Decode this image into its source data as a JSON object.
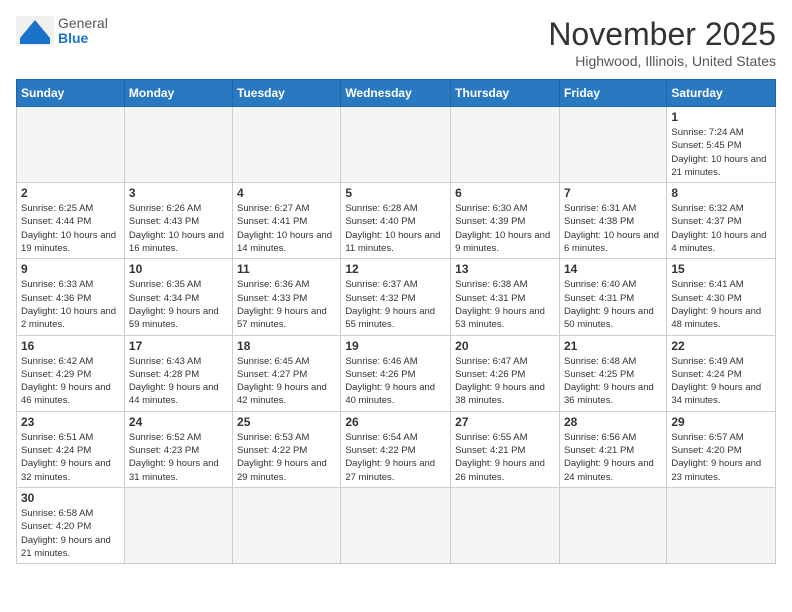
{
  "logo": {
    "general": "General",
    "blue": "Blue"
  },
  "title": "November 2025",
  "location": "Highwood, Illinois, United States",
  "weekdays": [
    "Sunday",
    "Monday",
    "Tuesday",
    "Wednesday",
    "Thursday",
    "Friday",
    "Saturday"
  ],
  "weeks": [
    [
      {
        "day": null,
        "info": null
      },
      {
        "day": null,
        "info": null
      },
      {
        "day": null,
        "info": null
      },
      {
        "day": null,
        "info": null
      },
      {
        "day": null,
        "info": null
      },
      {
        "day": null,
        "info": null
      },
      {
        "day": "1",
        "info": "Sunrise: 7:24 AM\nSunset: 5:45 PM\nDaylight: 10 hours and 21 minutes."
      }
    ],
    [
      {
        "day": "2",
        "info": "Sunrise: 6:25 AM\nSunset: 4:44 PM\nDaylight: 10 hours and 19 minutes."
      },
      {
        "day": "3",
        "info": "Sunrise: 6:26 AM\nSunset: 4:43 PM\nDaylight: 10 hours and 16 minutes."
      },
      {
        "day": "4",
        "info": "Sunrise: 6:27 AM\nSunset: 4:41 PM\nDaylight: 10 hours and 14 minutes."
      },
      {
        "day": "5",
        "info": "Sunrise: 6:28 AM\nSunset: 4:40 PM\nDaylight: 10 hours and 11 minutes."
      },
      {
        "day": "6",
        "info": "Sunrise: 6:30 AM\nSunset: 4:39 PM\nDaylight: 10 hours and 9 minutes."
      },
      {
        "day": "7",
        "info": "Sunrise: 6:31 AM\nSunset: 4:38 PM\nDaylight: 10 hours and 6 minutes."
      },
      {
        "day": "8",
        "info": "Sunrise: 6:32 AM\nSunset: 4:37 PM\nDaylight: 10 hours and 4 minutes."
      }
    ],
    [
      {
        "day": "9",
        "info": "Sunrise: 6:33 AM\nSunset: 4:36 PM\nDaylight: 10 hours and 2 minutes."
      },
      {
        "day": "10",
        "info": "Sunrise: 6:35 AM\nSunset: 4:34 PM\nDaylight: 9 hours and 59 minutes."
      },
      {
        "day": "11",
        "info": "Sunrise: 6:36 AM\nSunset: 4:33 PM\nDaylight: 9 hours and 57 minutes."
      },
      {
        "day": "12",
        "info": "Sunrise: 6:37 AM\nSunset: 4:32 PM\nDaylight: 9 hours and 55 minutes."
      },
      {
        "day": "13",
        "info": "Sunrise: 6:38 AM\nSunset: 4:31 PM\nDaylight: 9 hours and 53 minutes."
      },
      {
        "day": "14",
        "info": "Sunrise: 6:40 AM\nSunset: 4:31 PM\nDaylight: 9 hours and 50 minutes."
      },
      {
        "day": "15",
        "info": "Sunrise: 6:41 AM\nSunset: 4:30 PM\nDaylight: 9 hours and 48 minutes."
      }
    ],
    [
      {
        "day": "16",
        "info": "Sunrise: 6:42 AM\nSunset: 4:29 PM\nDaylight: 9 hours and 46 minutes."
      },
      {
        "day": "17",
        "info": "Sunrise: 6:43 AM\nSunset: 4:28 PM\nDaylight: 9 hours and 44 minutes."
      },
      {
        "day": "18",
        "info": "Sunrise: 6:45 AM\nSunset: 4:27 PM\nDaylight: 9 hours and 42 minutes."
      },
      {
        "day": "19",
        "info": "Sunrise: 6:46 AM\nSunset: 4:26 PM\nDaylight: 9 hours and 40 minutes."
      },
      {
        "day": "20",
        "info": "Sunrise: 6:47 AM\nSunset: 4:26 PM\nDaylight: 9 hours and 38 minutes."
      },
      {
        "day": "21",
        "info": "Sunrise: 6:48 AM\nSunset: 4:25 PM\nDaylight: 9 hours and 36 minutes."
      },
      {
        "day": "22",
        "info": "Sunrise: 6:49 AM\nSunset: 4:24 PM\nDaylight: 9 hours and 34 minutes."
      }
    ],
    [
      {
        "day": "23",
        "info": "Sunrise: 6:51 AM\nSunset: 4:24 PM\nDaylight: 9 hours and 32 minutes."
      },
      {
        "day": "24",
        "info": "Sunrise: 6:52 AM\nSunset: 4:23 PM\nDaylight: 9 hours and 31 minutes."
      },
      {
        "day": "25",
        "info": "Sunrise: 6:53 AM\nSunset: 4:22 PM\nDaylight: 9 hours and 29 minutes."
      },
      {
        "day": "26",
        "info": "Sunrise: 6:54 AM\nSunset: 4:22 PM\nDaylight: 9 hours and 27 minutes."
      },
      {
        "day": "27",
        "info": "Sunrise: 6:55 AM\nSunset: 4:21 PM\nDaylight: 9 hours and 26 minutes."
      },
      {
        "day": "28",
        "info": "Sunrise: 6:56 AM\nSunset: 4:21 PM\nDaylight: 9 hours and 24 minutes."
      },
      {
        "day": "29",
        "info": "Sunrise: 6:57 AM\nSunset: 4:20 PM\nDaylight: 9 hours and 23 minutes."
      }
    ],
    [
      {
        "day": "30",
        "info": "Sunrise: 6:58 AM\nSunset: 4:20 PM\nDaylight: 9 hours and 21 minutes."
      },
      {
        "day": null,
        "info": null
      },
      {
        "day": null,
        "info": null
      },
      {
        "day": null,
        "info": null
      },
      {
        "day": null,
        "info": null
      },
      {
        "day": null,
        "info": null
      },
      {
        "day": null,
        "info": null
      }
    ]
  ]
}
